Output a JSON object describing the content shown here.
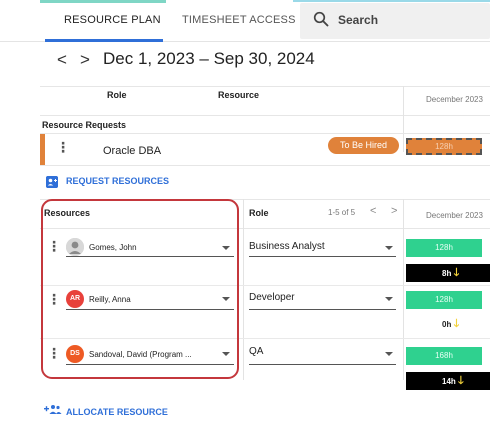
{
  "tabs": [
    {
      "label": "RESOURCE PLAN",
      "active": true
    },
    {
      "label": "TIMESHEET ACCESS",
      "active": false
    }
  ],
  "search": {
    "label": "Search"
  },
  "date_nav": {
    "prev": "<",
    "next": ">",
    "range": "Dec 1, 2023 – Sep 30, 2024"
  },
  "grid_header": {
    "role": "Role",
    "resource": "Resource",
    "month": "December 2023"
  },
  "resource_requests": {
    "title": "Resource Requests",
    "rows": [
      {
        "role": "Oracle DBA",
        "status": "To Be Hired",
        "hours": "128h"
      }
    ],
    "button": "REQUEST RESOURCES"
  },
  "allocation": {
    "header": {
      "resources": "Resources",
      "role": "Role",
      "pagination": "1-5 of 5",
      "prev": "<",
      "next": ">",
      "month": "December 2023"
    },
    "rows": [
      {
        "initials": "",
        "name": "Gomes, John",
        "avatar_color": "#cfcfcf",
        "role": "Business Analyst",
        "hours": "128h",
        "delta": "8h",
        "delta_style": "dark"
      },
      {
        "initials": "AR",
        "name": "Reilly, Anna",
        "avatar_color": "#e8413b",
        "role": "Developer",
        "hours": "128h",
        "delta": "0h",
        "delta_style": "light"
      },
      {
        "initials": "DS",
        "name": "Sandoval, David (Program ...",
        "avatar_color": "#ee5a24",
        "role": "QA",
        "hours": "168h",
        "delta": "14h",
        "delta_style": "dark"
      }
    ],
    "button": "ALLOCATE RESOURCE"
  },
  "colors": {
    "accent": "#2f6fd8",
    "request": "#e0823a",
    "allocated": "#2fd18f",
    "highlight": "#c4373c",
    "arrow": "#f3d23b"
  },
  "icons": {
    "search": "search-icon",
    "request": "person-add-icon",
    "allocate": "group-add-icon",
    "kebab": "more-vert-icon",
    "arrow": "arrow-down-icon"
  }
}
